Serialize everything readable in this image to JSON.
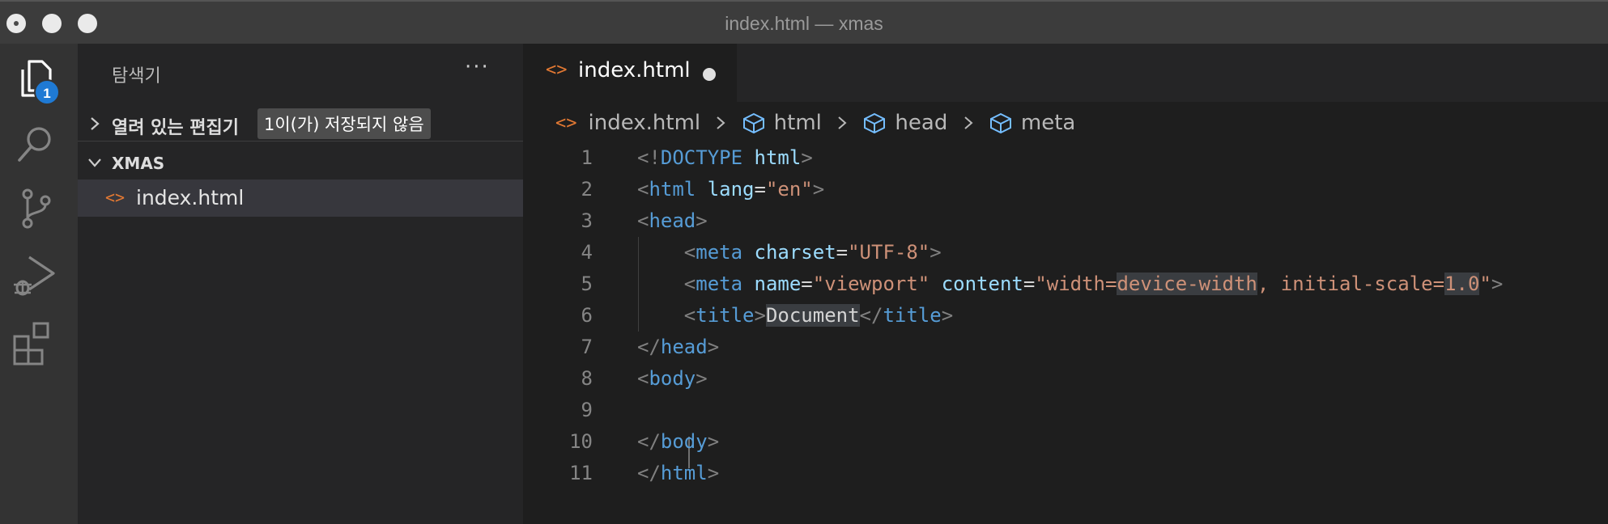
{
  "window": {
    "title": "index.html — xmas"
  },
  "activity_bar": {
    "items": [
      {
        "name": "explorer-icon",
        "badge": "1"
      },
      {
        "name": "search-icon"
      },
      {
        "name": "source-control-icon"
      },
      {
        "name": "run-debug-icon"
      },
      {
        "name": "extensions-icon"
      }
    ]
  },
  "sidebar": {
    "header": "탐색기",
    "more": "···",
    "open_editors": {
      "label": "열려 있는 편집기",
      "unsaved": "1이(가) 저장되지 않음"
    },
    "folder": {
      "label": "XMAS"
    },
    "files": [
      {
        "icon": "<>",
        "name": "index.html"
      }
    ]
  },
  "editor": {
    "tab": {
      "icon": "<>",
      "name": "index.html",
      "modified": true
    },
    "breadcrumb": [
      {
        "icon": "html-file-icon",
        "label": "index.html"
      },
      {
        "icon": "cube-icon",
        "label": "html"
      },
      {
        "icon": "cube-icon",
        "label": "head"
      },
      {
        "icon": "cube-icon",
        "label": "meta"
      }
    ],
    "lines": [
      {
        "n": "1",
        "tokens": [
          [
            "p",
            "<!"
          ],
          [
            "tg",
            "DOCTYPE"
          ],
          [
            "tx",
            " "
          ],
          [
            "at",
            "html"
          ],
          [
            "p",
            ">"
          ]
        ]
      },
      {
        "n": "2",
        "tokens": [
          [
            "p",
            "<"
          ],
          [
            "tg",
            "html"
          ],
          [
            "tx",
            " "
          ],
          [
            "at",
            "lang"
          ],
          [
            "tx",
            "="
          ],
          [
            "st",
            "\"en\""
          ],
          [
            "p",
            ">"
          ]
        ]
      },
      {
        "n": "3",
        "tokens": [
          [
            "p",
            "<"
          ],
          [
            "tg",
            "head"
          ],
          [
            "p",
            ">"
          ]
        ]
      },
      {
        "n": "4",
        "tokens": [
          [
            "tx",
            "    "
          ],
          [
            "p",
            "<"
          ],
          [
            "tg",
            "meta"
          ],
          [
            "tx",
            " "
          ],
          [
            "at",
            "charset"
          ],
          [
            "tx",
            "="
          ],
          [
            "st",
            "\"UTF-8\""
          ],
          [
            "p",
            ">"
          ]
        ]
      },
      {
        "n": "5",
        "tokens": [
          [
            "tx",
            "    "
          ],
          [
            "p",
            "<"
          ],
          [
            "tg",
            "meta"
          ],
          [
            "tx",
            " "
          ],
          [
            "at",
            "name"
          ],
          [
            "tx",
            "="
          ],
          [
            "st",
            "\"viewport\""
          ],
          [
            "tx",
            " "
          ],
          [
            "at",
            "content"
          ],
          [
            "tx",
            "="
          ],
          [
            "st",
            "\"width="
          ],
          [
            "st hl",
            "device-width"
          ],
          [
            "st",
            ", initial-scale="
          ],
          [
            "st hl",
            "1.0"
          ],
          [
            "st",
            "\""
          ],
          [
            "p",
            ">"
          ]
        ]
      },
      {
        "n": "6",
        "tokens": [
          [
            "tx",
            "    "
          ],
          [
            "p",
            "<"
          ],
          [
            "tg",
            "title"
          ],
          [
            "p",
            ">"
          ],
          [
            "tx hl",
            "Document"
          ],
          [
            "p",
            "</"
          ],
          [
            "tg",
            "title"
          ],
          [
            "p",
            ">"
          ]
        ]
      },
      {
        "n": "7",
        "tokens": [
          [
            "p",
            "</"
          ],
          [
            "tg",
            "head"
          ],
          [
            "p",
            ">"
          ]
        ]
      },
      {
        "n": "8",
        "tokens": [
          [
            "p",
            "<"
          ],
          [
            "tg",
            "body"
          ],
          [
            "p",
            ">"
          ]
        ]
      },
      {
        "n": "9",
        "tokens": []
      },
      {
        "n": "10",
        "tokens": [
          [
            "p",
            "</"
          ],
          [
            "tg",
            "body"
          ],
          [
            "p",
            ">"
          ]
        ]
      },
      {
        "n": "11",
        "tokens": [
          [
            "p",
            "</"
          ],
          [
            "tg",
            "html"
          ],
          [
            "p",
            ">"
          ]
        ]
      }
    ]
  }
}
